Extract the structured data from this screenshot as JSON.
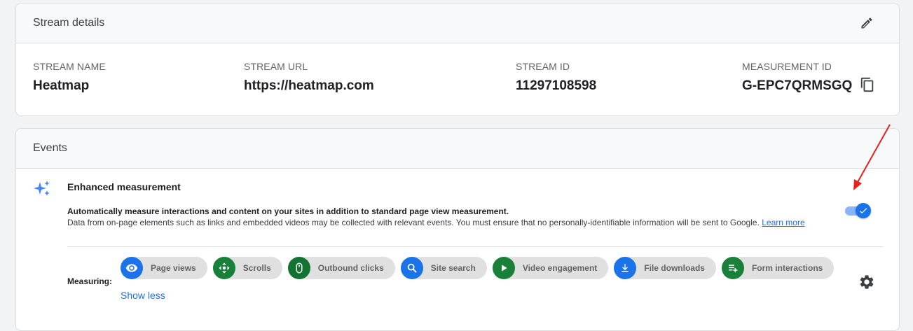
{
  "stream_details": {
    "title": "Stream details",
    "edit_icon": "pencil-icon",
    "fields": [
      {
        "label": "STREAM NAME",
        "value": "Heatmap"
      },
      {
        "label": "STREAM URL",
        "value": "https://heatmap.com"
      },
      {
        "label": "STREAM ID",
        "value": "11297108598"
      },
      {
        "label": "MEASUREMENT ID",
        "value": "G-EPC7QRMSGQ"
      }
    ],
    "copy_icon": "copy-icon"
  },
  "events": {
    "title": "Events",
    "enhanced_measurement": {
      "icon": "sparkle-icon",
      "title": "Enhanced measurement",
      "description_bold": "Automatically measure interactions and content on your sites in addition to standard page view measurement.",
      "description": "Data from on-page elements such as links and embedded videos may be collected with relevant events. You must ensure that no personally-identifiable information will be sent to Google.",
      "learn_more": "Learn more",
      "toggle_on": true,
      "measuring_label": "Measuring:",
      "chips": [
        {
          "label": "Page views",
          "icon": "eye-icon",
          "color": "#1a73e8"
        },
        {
          "label": "Scrolls",
          "icon": "scroll-arrows-icon",
          "color": "#188038"
        },
        {
          "label": "Outbound clicks",
          "icon": "mouse-icon",
          "color": "#137333"
        },
        {
          "label": "Site search",
          "icon": "search-icon",
          "color": "#1a73e8"
        },
        {
          "label": "Video engagement",
          "icon": "play-icon",
          "color": "#188038"
        },
        {
          "label": "File downloads",
          "icon": "download-icon",
          "color": "#1a73e8"
        },
        {
          "label": "Form interactions",
          "icon": "form-list-icon",
          "color": "#188038"
        }
      ],
      "show_less": "Show less",
      "settings_icon": "gear-icon"
    }
  },
  "colors": {
    "accent": "#1a73e8",
    "annotation_arrow": "#e8221b"
  }
}
